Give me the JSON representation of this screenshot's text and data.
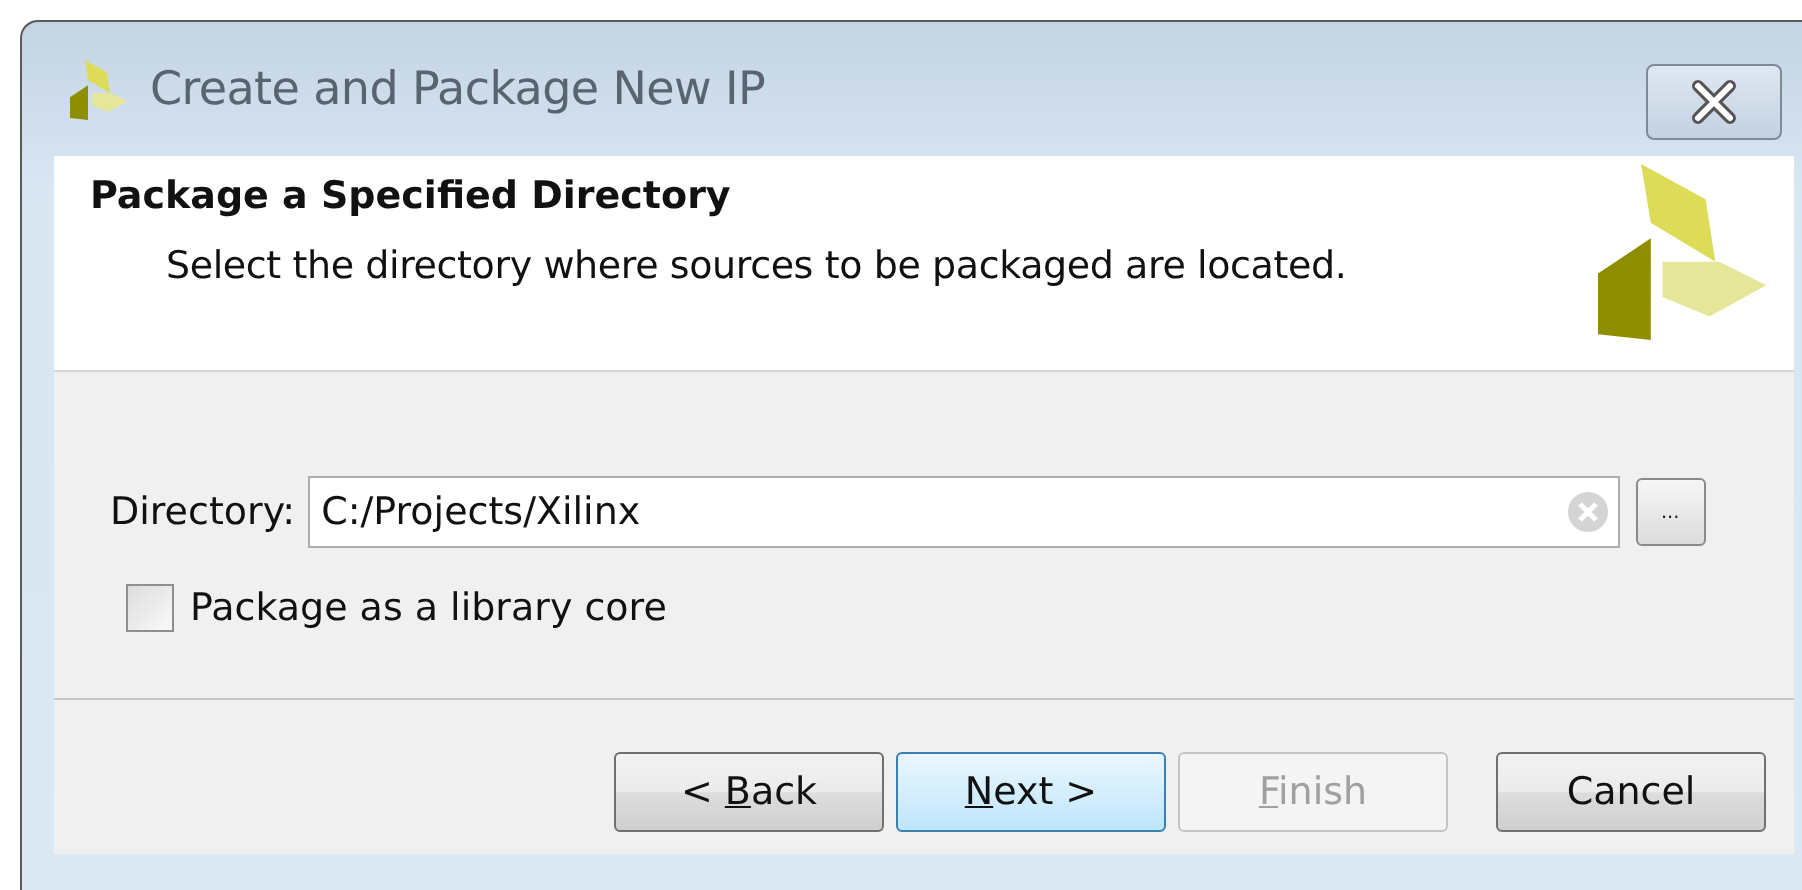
{
  "window": {
    "title": "Create and Package New IP"
  },
  "header": {
    "title": "Package a Specified Directory",
    "subtitle": "Select the directory where sources to be packaged are located."
  },
  "directory": {
    "label": "Directory:",
    "value": "C:/Projects/Xilinx",
    "browse": "..."
  },
  "library_core": {
    "label": "Package as a library core",
    "checked": false
  },
  "buttons": [
    {
      "label_before": "< ",
      "mnemonic": "B",
      "label": "ack",
      "disabled": false,
      "selected": false
    },
    {
      "mnemonic": "N",
      "label": "ext >",
      "disabled": false,
      "selected": true
    },
    {
      "mnemonic": "F",
      "label": "inish",
      "disabled": true,
      "selected": false
    },
    {
      "label": "Cancel",
      "disabled": false,
      "selected": false
    }
  ]
}
